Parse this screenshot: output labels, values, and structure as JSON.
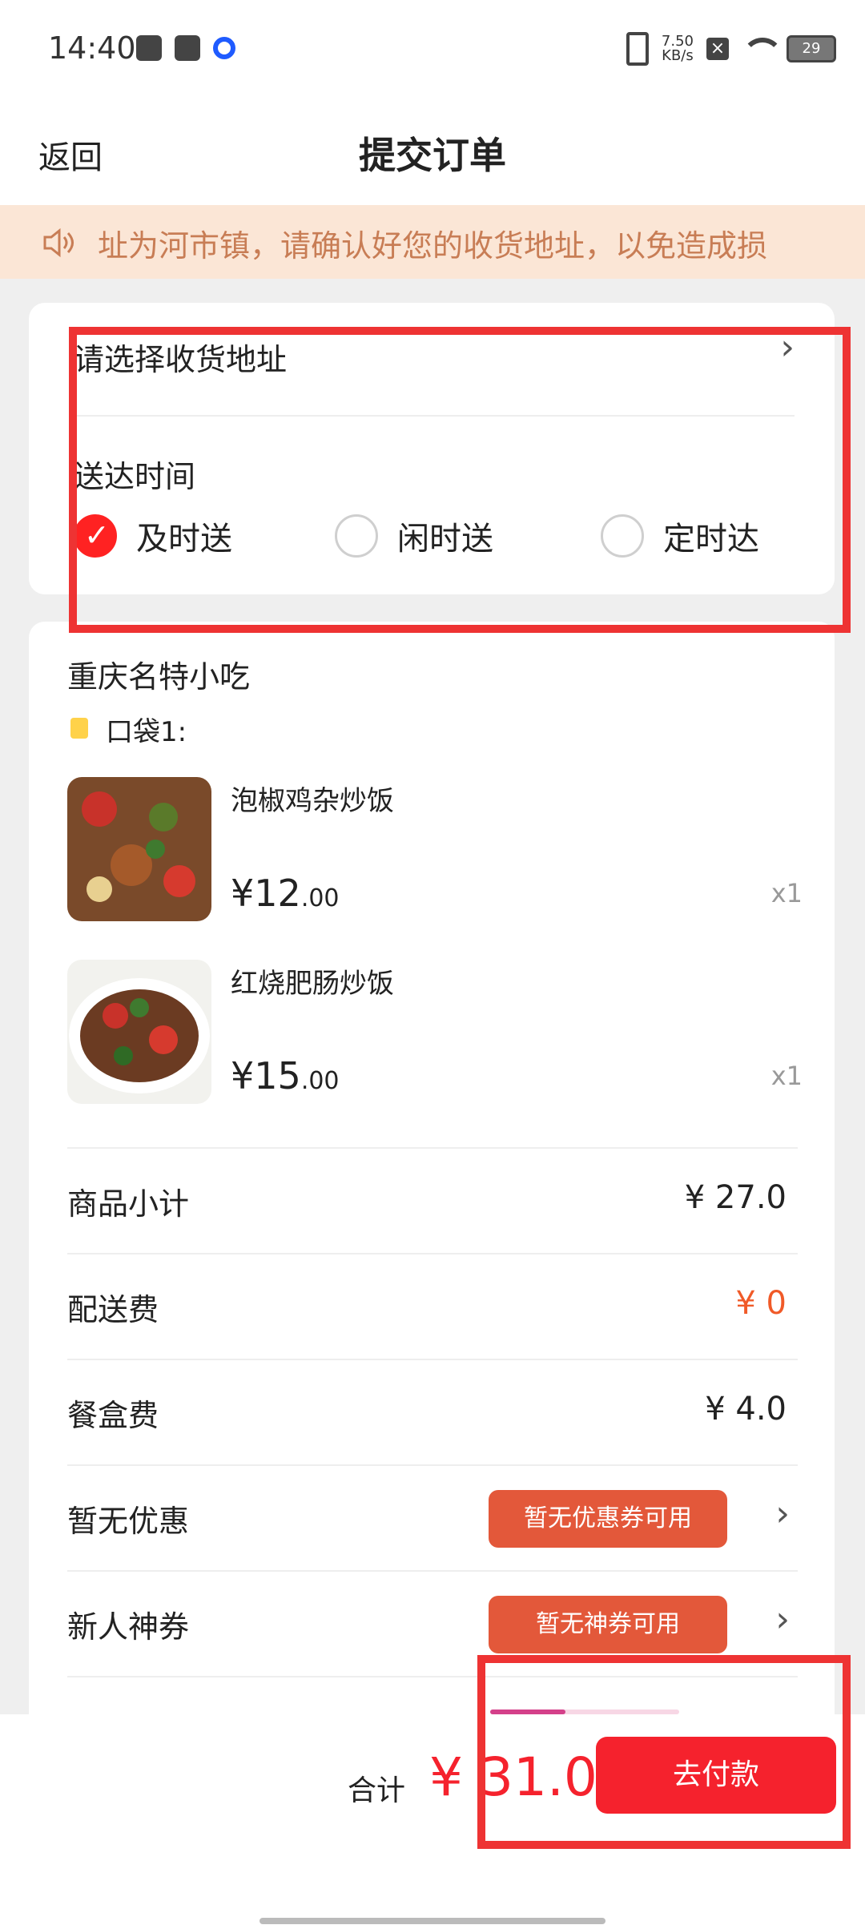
{
  "status_bar": {
    "time": "14:40",
    "net_speed": "7.50\nKB/s",
    "battery": "29"
  },
  "nav": {
    "back_label": "返回",
    "title": "提交订单"
  },
  "notice": {
    "text": "址为河市镇，请确认好您的收货地址，以免造成损"
  },
  "address": {
    "label": "请选择收货地址"
  },
  "delivery": {
    "label": "送达时间",
    "options": [
      {
        "label": "及时送",
        "selected": true
      },
      {
        "label": "闲时送",
        "selected": false
      },
      {
        "label": "定时达",
        "selected": false
      }
    ]
  },
  "shop": {
    "name": "重庆名特小吃",
    "bag_label": "口袋1:"
  },
  "items": [
    {
      "name": "泡椒鸡杂炒饭",
      "price_int": "¥12",
      "price_dec": ".00",
      "qty": "x1"
    },
    {
      "name": "红烧肥肠炒饭",
      "price_int": "¥15",
      "price_dec": ".00",
      "qty": "x1"
    }
  ],
  "summary": [
    {
      "label": "商品小计",
      "value": "¥ 27.0"
    },
    {
      "label": "配送费",
      "value": "¥ 0"
    },
    {
      "label": "餐盒费",
      "value": "¥ 4.0"
    }
  ],
  "coupons": [
    {
      "label": "暂无优惠",
      "badge": "暂无优惠券可用"
    },
    {
      "label": "新人神券",
      "badge": "暂无神券可用"
    }
  ],
  "footer": {
    "total_label": "合计",
    "total_amount": "¥ 31.0",
    "pay_label": "去付款"
  },
  "colors": {
    "accent": "#f5222d",
    "notice_bg": "#fbe6d6",
    "badge": "#e3583a",
    "orange": "#f05a28"
  }
}
